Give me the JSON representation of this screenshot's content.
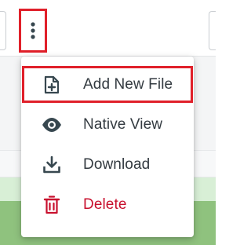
{
  "colors": {
    "highlight": "#e0202a",
    "icon": "#37474f",
    "danger": "#c8102e",
    "text": "#333a40"
  },
  "toolbar": {
    "more_icon": "more-vertical-icon"
  },
  "menu": {
    "items": [
      {
        "label": "Add New File",
        "icon": "file-plus-icon",
        "highlighted": true
      },
      {
        "label": "Native View",
        "icon": "eye-icon",
        "highlighted": false
      },
      {
        "label": "Download",
        "icon": "download-icon",
        "highlighted": false
      },
      {
        "label": "Delete",
        "icon": "trash-icon",
        "highlighted": false,
        "danger": true
      }
    ]
  }
}
